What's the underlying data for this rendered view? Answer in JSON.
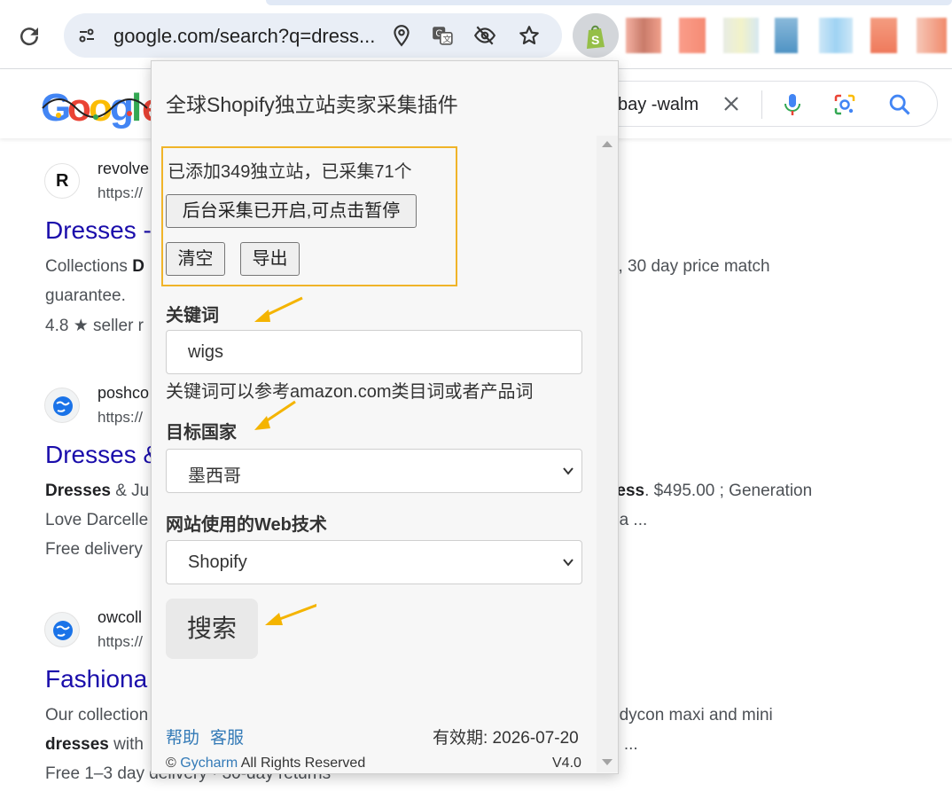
{
  "browser": {
    "url": "google.com/search?q=dress...",
    "icons": [
      "reload-icon",
      "site-info-icon",
      "location-icon",
      "translate-icon",
      "eye-off-icon",
      "star-icon",
      "shopify-extension-icon"
    ]
  },
  "google": {
    "logo_letters": [
      "G",
      "o",
      "o",
      "g",
      "l",
      "e"
    ],
    "search_text": "bay -walm"
  },
  "results": [
    {
      "favicon": "R",
      "site": "revolve",
      "crumb": "https://",
      "title": "Dresses -",
      "snippet_lines": [
        {
          "bold": "",
          "start": "Collections ",
          "strong": "D",
          "tail": ""
        },
        {
          "bold": "",
          "start": "guarantee.",
          "strong": "",
          "tail": ""
        }
      ],
      "meta": "4.8 ★ seller r",
      "right_line": "s, 30 day price match"
    },
    {
      "favicon": "globe",
      "site": "poshco",
      "crumb": "https://",
      "title": "Dresses &",
      "snippet_lines": [
        {
          "start": "",
          "strong": "Dresses",
          "tail": " & Ju"
        },
        {
          "start": "Love Darcelle",
          "strong": "",
          "tail": ""
        }
      ],
      "meta": "Free delivery",
      "right_strong": "ress",
      "right_line": ". $495.00 ; Generation",
      "right_line2": "na ..."
    },
    {
      "favicon": "globe",
      "site": "owcoll",
      "crumb": "https://",
      "title": "Fashiona",
      "snippet_lines": [
        {
          "start": "Our collection",
          "strong": "",
          "tail": ""
        },
        {
          "start": "",
          "strong": "dresses",
          "tail": " with"
        }
      ],
      "meta": "Free 1–3 day delivery · 30-day returns",
      "right_line": "odycon maxi and mini",
      "right_line2": "n ..."
    }
  ],
  "popup": {
    "title": "全球Shopify独立站卖家采集插件",
    "stats": "已添加349独立站，已采集71个",
    "toggle_button": "后台采集已开启,可点击暂停",
    "clear_button": "清空",
    "export_button": "导出",
    "keyword_label": "关键词",
    "keyword_value": "wigs",
    "keyword_hint": "关键词可以参考amazon.com类目词或者产品词",
    "country_label": "目标国家",
    "country_value": "墨西哥",
    "tech_label": "网站使用的Web技术",
    "tech_value": "Shopify",
    "search_button": "搜索",
    "help_link": "帮助",
    "service_link": "客服",
    "expiry": "有效期: 2026-07-20",
    "copyright_prefix": "©",
    "copyright_link": "Gycharm",
    "copyright_suffix": "All Rights Reserved",
    "version": "V4.0"
  },
  "colors": {
    "accent_border": "#f0b429",
    "link": "#337ab7",
    "result_title": "#1a0dab",
    "arrow": "#f4b400"
  }
}
